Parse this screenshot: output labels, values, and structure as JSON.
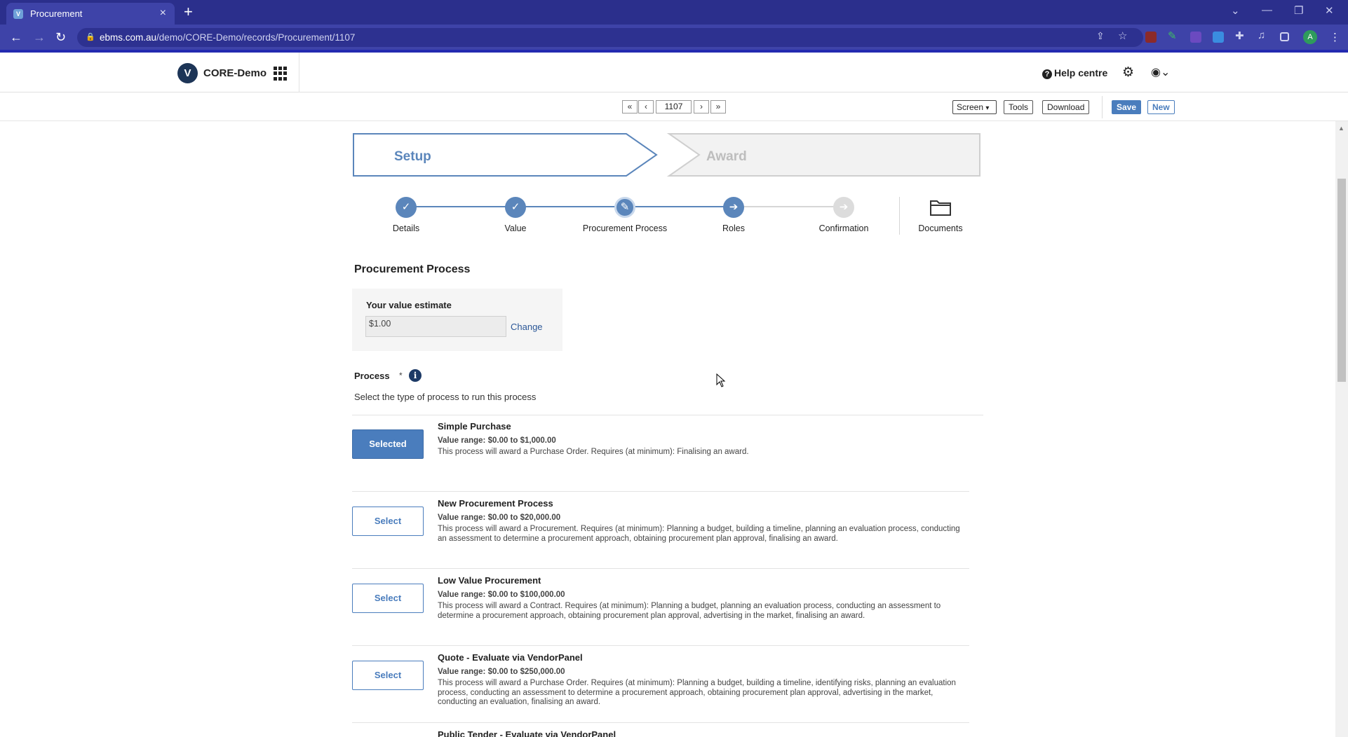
{
  "browser": {
    "tab_title": "Procurement",
    "url_host": "ebms.com.au",
    "url_path": "/demo/CORE-Demo/records/Procurement/1107",
    "profile_initial": "A"
  },
  "app": {
    "name": "CORE-Demo",
    "logo_letter": "V",
    "help_label": "Help centre"
  },
  "toolbar": {
    "record_number": "1107",
    "screen_select": "Screen",
    "tools_label": "Tools",
    "download_label": "Download",
    "save_label": "Save",
    "new_label": "New"
  },
  "stages": [
    {
      "label": "Setup",
      "active": true
    },
    {
      "label": "Award",
      "active": false
    }
  ],
  "steps": [
    {
      "label": "Details",
      "state": "done",
      "icon": "check-icon"
    },
    {
      "label": "Value",
      "state": "done",
      "icon": "check-icon"
    },
    {
      "label": "Procurement Process",
      "state": "current",
      "icon": "pencil-icon"
    },
    {
      "label": "Roles",
      "state": "next",
      "icon": "arrow-right-icon"
    },
    {
      "label": "Confirmation",
      "state": "pending",
      "icon": "arrow-right-icon"
    }
  ],
  "documents_label": "Documents",
  "section": {
    "title": "Procurement Process",
    "estimate_label": "Your value estimate",
    "estimate_value": "$1.00",
    "change_label": "Change",
    "process_label": "Process",
    "required_mark": "*",
    "process_help": "Select the type of process to run this process"
  },
  "options": [
    {
      "button": "Selected",
      "selected": true,
      "name": "Simple Purchase",
      "range": "Value range: $0.00 to $1,000.00",
      "description": "This process will award a Purchase Order. Requires (at minimum): Finalising an award."
    },
    {
      "button": "Select",
      "selected": false,
      "name": "New Procurement Process",
      "range": "Value range: $0.00 to $20,000.00",
      "description": "This process will award a Procurement. Requires (at minimum): Planning a budget, building a timeline, planning an evaluation process, conducting an assessment to determine a procurement approach, obtaining procurement plan approval, finalising an award."
    },
    {
      "button": "Select",
      "selected": false,
      "name": "Low Value Procurement",
      "range": "Value range: $0.00 to $100,000.00",
      "description": "This process will award a Contract. Requires (at minimum): Planning a budget, planning an evaluation process, conducting an assessment to determine a procurement approach, obtaining procurement plan approval, advertising in the market, finalising an award."
    },
    {
      "button": "Select",
      "selected": false,
      "name": "Quote - Evaluate via VendorPanel",
      "range": "Value range: $0.00 to $250,000.00",
      "description": "This process will award a Purchase Order. Requires (at minimum): Planning a budget, building a timeline, identifying risks, planning an evaluation process, conducting an assessment to determine a procurement approach, obtaining procurement plan approval, advertising in the market, conducting an evaluation, finalising an award."
    },
    {
      "button": "Select",
      "selected": false,
      "name": "Public Tender - Evaluate via VendorPanel",
      "range": "",
      "description": ""
    }
  ],
  "colors": {
    "browser_frame": "#3e43a8",
    "accent": "#4a7dbd",
    "step_done": "#5b86bb",
    "step_pending": "#d6d6d6"
  }
}
